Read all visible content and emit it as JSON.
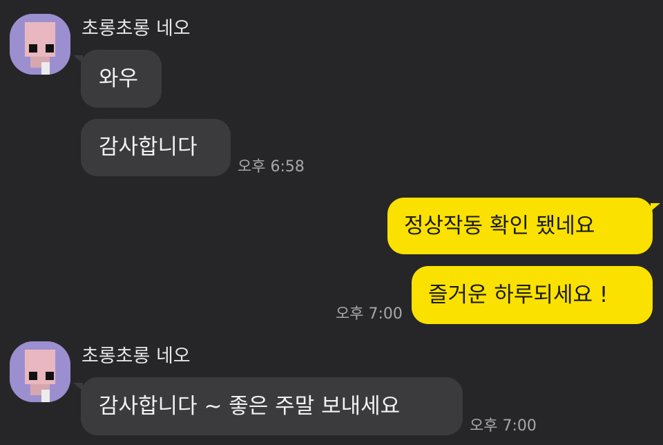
{
  "colors": {
    "background": "#262628",
    "incoming_bubble": "#3b3b3d",
    "outgoing_bubble": "#fae100",
    "timestamp": "#a8a8a8"
  },
  "groups": [
    {
      "sender": "초롱초롱 네오",
      "avatar_icon": "pixelated-profile-avatar",
      "messages": [
        "와우",
        "감사합니다"
      ],
      "time": "오후 6:58"
    },
    {
      "sender": "",
      "messages": [
        "정상작동 확인 됐네요",
        "즐거운 하루되세요 !"
      ],
      "time": "오후 7:00"
    },
    {
      "sender": "초롱초롱 네오",
      "avatar_icon": "pixelated-profile-avatar",
      "messages": [
        "감사합니다 ~ 좋은 주말 보내세요"
      ],
      "time": "오후 7:00"
    }
  ]
}
